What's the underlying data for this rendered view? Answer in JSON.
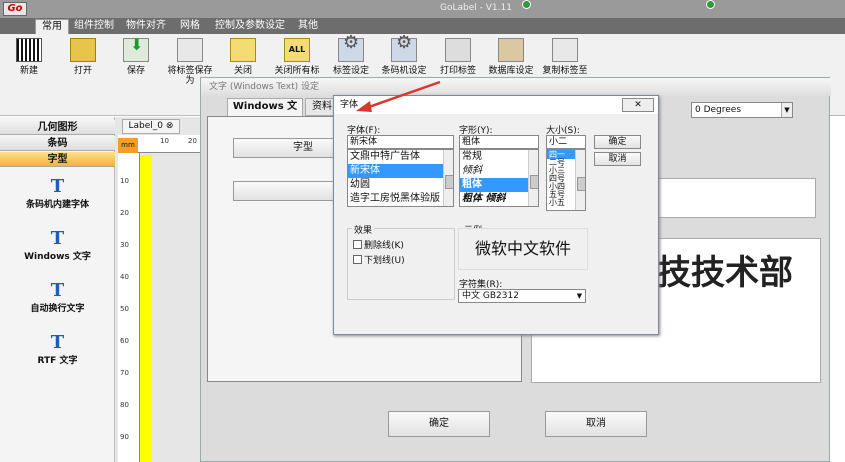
{
  "app": {
    "title": "GoLabel - V1.11",
    "logo": "Go"
  },
  "menu": {
    "tabs": [
      "常用",
      "组件控制",
      "物件对齐",
      "网格",
      "控制及参数设定",
      "其他"
    ],
    "active": 0
  },
  "toolbar": {
    "items": [
      {
        "label": "新建",
        "icon": "barcode-icon"
      },
      {
        "label": "打开",
        "icon": "open-icon"
      },
      {
        "label": "保存",
        "icon": "save-icon"
      },
      {
        "label": "将标签保存为",
        "icon": "save-as-icon"
      },
      {
        "label": "关闭",
        "icon": "close-folder-icon"
      },
      {
        "label": "关闭所有标",
        "icon": "close-all-icon"
      },
      {
        "label": "标签设定",
        "icon": "label-settings-icon"
      },
      {
        "label": "条码机设定",
        "icon": "printer-settings-icon"
      },
      {
        "label": "打印标签",
        "icon": "print-icon"
      },
      {
        "label": "数据库设定",
        "icon": "database-icon"
      },
      {
        "label": "复制标签至",
        "icon": "copy-label-icon"
      }
    ]
  },
  "sidebar": {
    "sections": [
      "几何图形",
      "条码",
      "字型"
    ],
    "active": 2,
    "items": [
      {
        "label": "条码机内建字体"
      },
      {
        "label": "Windows 文字"
      },
      {
        "label": "自动换行文字"
      },
      {
        "label": "RTF 文字"
      }
    ]
  },
  "document": {
    "tab": "Label_0",
    "unit": "mm",
    "ruler_top": [
      "10",
      "20"
    ],
    "ruler_left": [
      "10",
      "20",
      "30",
      "40",
      "50",
      "60",
      "70",
      "80",
      "90"
    ]
  },
  "windows_text_dialog": {
    "title": "文字 (Windows Text) 设定",
    "tabs": [
      "Windows 文字",
      "资料"
    ],
    "font_button": "字型",
    "rotation": "0 Degrees",
    "preview_text": "技技术部",
    "ok": "确定",
    "cancel": "取消"
  },
  "font_dialog": {
    "title": "字体",
    "font_label": "字体(F):",
    "font_value": "新宋体",
    "fonts": [
      "文鼎中特广告体",
      "新宋体",
      "幼圆",
      "造字工房悦黑体验版"
    ],
    "style_label": "字形(Y):",
    "style_value": "粗体",
    "styles": [
      "常规",
      "倾斜",
      "粗体",
      "粗体 倾斜"
    ],
    "size_label": "大小(S):",
    "size_value": "小二",
    "sizes": [
      "四一",
      "二号",
      "小三",
      "四号",
      "小四",
      "五号",
      "小五"
    ],
    "ok": "确定",
    "cancel": "取消",
    "effects_label": "效果",
    "strike": "删除线(K)",
    "underline": "下划线(U)",
    "sample_label": "示例",
    "sample_text": "微软中文软件",
    "charset_label": "字符集(R):",
    "charset_value": "中文 GB2312"
  },
  "colors": {
    "accent": "#3399ff",
    "sidebar_selected": "#f3b23c",
    "arrow": "#d9372e"
  }
}
